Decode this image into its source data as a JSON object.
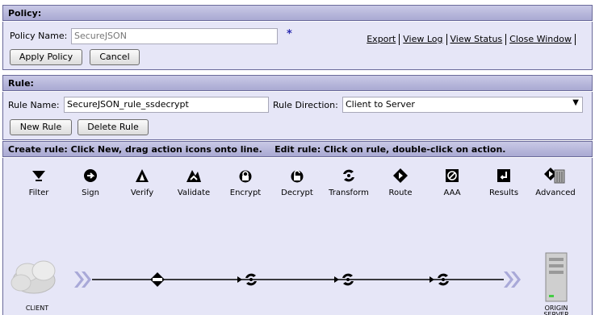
{
  "policy": {
    "header": "Policy:",
    "name_label": "Policy Name:",
    "name_value": "SecureJSON",
    "required_mark": "*",
    "apply_button": "Apply Policy",
    "cancel_button": "Cancel",
    "links": [
      "Export",
      "View Log",
      "View Status",
      "Close Window"
    ]
  },
  "rule": {
    "header": "Rule:",
    "name_label": "Rule Name:",
    "name_value": "SecureJSON_rule_ssdecrypt",
    "direction_label": "Rule Direction:",
    "direction_value": "Client to Server",
    "new_button": "New Rule",
    "delete_button": "Delete Rule"
  },
  "instructions": "Create rule: Click New, drag action icons onto line.    Edit rule: Click on rule, double-click on action.",
  "palette": [
    {
      "label": "Filter",
      "icon": "filter-icon"
    },
    {
      "label": "Sign",
      "icon": "sign-icon"
    },
    {
      "label": "Verify",
      "icon": "verify-icon"
    },
    {
      "label": "Validate",
      "icon": "validate-icon"
    },
    {
      "label": "Encrypt",
      "icon": "encrypt-icon"
    },
    {
      "label": "Decrypt",
      "icon": "decrypt-icon"
    },
    {
      "label": "Transform",
      "icon": "transform-icon"
    },
    {
      "label": "Route",
      "icon": "route-icon"
    },
    {
      "label": "AAA",
      "icon": "aaa-icon"
    },
    {
      "label": "Results",
      "icon": "results-icon"
    },
    {
      "label": "Advanced",
      "icon": "advanced-icon"
    }
  ],
  "flow": {
    "client_label": "CLIENT",
    "server_label": "ORIGIN SERVER",
    "actions": [
      "route-icon",
      "transform-icon",
      "transform-icon",
      "transform-icon"
    ]
  },
  "colors": {
    "panel_bg": "#e6e6f7",
    "header_bg": "#b5b5dc",
    "accent_required": "#2a2ab0"
  }
}
